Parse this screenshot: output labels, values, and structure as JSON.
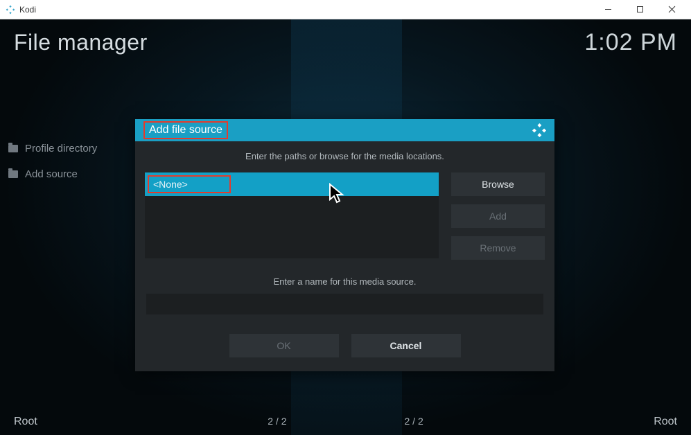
{
  "window": {
    "title": "Kodi"
  },
  "header": {
    "page_title": "File manager",
    "clock": "1:02 PM"
  },
  "sidebar": {
    "items": [
      {
        "label": "Profile directory"
      },
      {
        "label": "Add source"
      }
    ]
  },
  "footer": {
    "left": "Root",
    "center1": "2 / 2",
    "center2": "2 / 2",
    "right": "Root"
  },
  "dialog": {
    "title": "Add file source",
    "instruction": "Enter the paths or browse for the media locations.",
    "path_selected": "<None>",
    "browse_label": "Browse",
    "add_label": "Add",
    "remove_label": "Remove",
    "name_label": "Enter a name for this media source.",
    "name_value": "",
    "ok_label": "OK",
    "cancel_label": "Cancel"
  }
}
